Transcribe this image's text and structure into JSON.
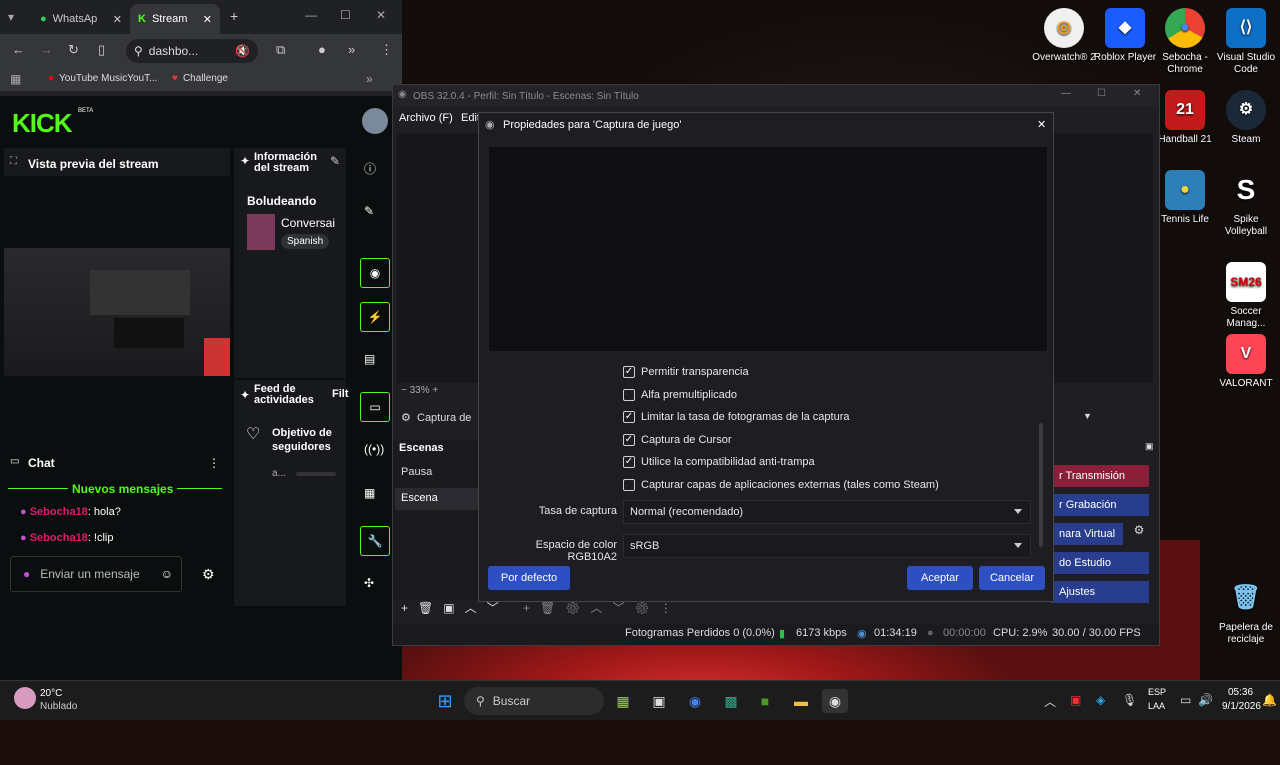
{
  "chrome": {
    "tabs": [
      {
        "label": "WhatsAp"
      },
      {
        "label": "Stream"
      }
    ],
    "new_tab": "+",
    "address": "dashbo...",
    "bookmarks": [
      {
        "label": "YouTube MusicYouT..."
      },
      {
        "label": "Challenge"
      }
    ]
  },
  "kick": {
    "logo": "KICK",
    "beta": "BETA",
    "preview_title": "Vista previa del stream",
    "info_title": "Información del stream",
    "stream_name": "Boludeando",
    "category": "Conversai",
    "language": "Spanish",
    "feed_title": "Feed de actividades",
    "feed_filter": "Filt",
    "goal_title": "Objetivo de seguidores",
    "goal_sub": "a...",
    "chat_title": "Chat",
    "new_messages": "Nuevos mensajes",
    "messages": [
      {
        "user": "Sebocha18",
        "text": ": hola?"
      },
      {
        "user": "Sebocha18",
        "text": ": !clip"
      }
    ],
    "chat_placeholder": "Enviar un mensaje"
  },
  "obs": {
    "title": "OBS 32.0.4 - Perfil: Sin Título - Escenas: Sin Título",
    "menu": [
      {
        "label": "Archivo (F)"
      },
      {
        "label": "Edit"
      }
    ],
    "zoom": "33%",
    "source": "Captura de",
    "scenes_title": "Escenas",
    "scenes": [
      {
        "label": "Pausa"
      },
      {
        "label": "Escena"
      }
    ],
    "controls": [
      {
        "label": "r Transmisión"
      },
      {
        "label": "r Grabación"
      },
      {
        "label": "nara Virtual"
      },
      {
        "label": "do Estudio"
      },
      {
        "label": "Ajustes"
      }
    ],
    "status": {
      "dropped": "Fotogramas Perdidos 0 (0.0%)",
      "bitrate": "6173 kbps",
      "time": "01:34:19",
      "rec": "00:00:00",
      "cpu": "CPU: 2.9%",
      "fps": "30.00 / 30.00 FPS"
    }
  },
  "dialog": {
    "title": "Propiedades para 'Captura de juego'",
    "checkboxes": [
      {
        "label": "Permitir transparencia",
        "checked": true
      },
      {
        "label": "Alfa premultiplicado",
        "checked": false
      },
      {
        "label": "Limitar la tasa de fotogramas de la captura",
        "checked": true
      },
      {
        "label": "Captura de Cursor",
        "checked": true
      },
      {
        "label": "Utilice la compatibilidad anti-trampa",
        "checked": true
      },
      {
        "label": "Capturar capas de aplicaciones externas (tales como Steam)",
        "checked": false
      }
    ],
    "rate_label": "Tasa de captura",
    "rate_value": "Normal (recomendado)",
    "color_label": "Espacio de color RGB10A2",
    "color_value": "sRGB",
    "defaults": "Por defecto",
    "accept": "Aceptar",
    "cancel": "Cancelar"
  },
  "desktop_icons": [
    {
      "label": "Overwatch® 2"
    },
    {
      "label": "Roblox Player"
    },
    {
      "label": "Sebocha - Chrome"
    },
    {
      "label": "Visual Studio Code"
    },
    {
      "label": "Handball 21"
    },
    {
      "label": "Steam"
    },
    {
      "label": "Tennis Life"
    },
    {
      "label": "Spike Volleyball"
    },
    {
      "label": "Soccer Manag..."
    },
    {
      "label": "VALORANT"
    },
    {
      "label": "Papelera de reciclaje"
    }
  ],
  "taskbar": {
    "weather_temp": "20°C",
    "weather_desc": "Nublado",
    "search": "Buscar",
    "lang1": "ESP",
    "lang2": "LAA",
    "time": "05:36",
    "date": "9/1/2026"
  },
  "colors": {
    "kick_green": "#53fc18",
    "obs_blue": "#2d4fc1",
    "chat_user": "#e21b6b"
  }
}
